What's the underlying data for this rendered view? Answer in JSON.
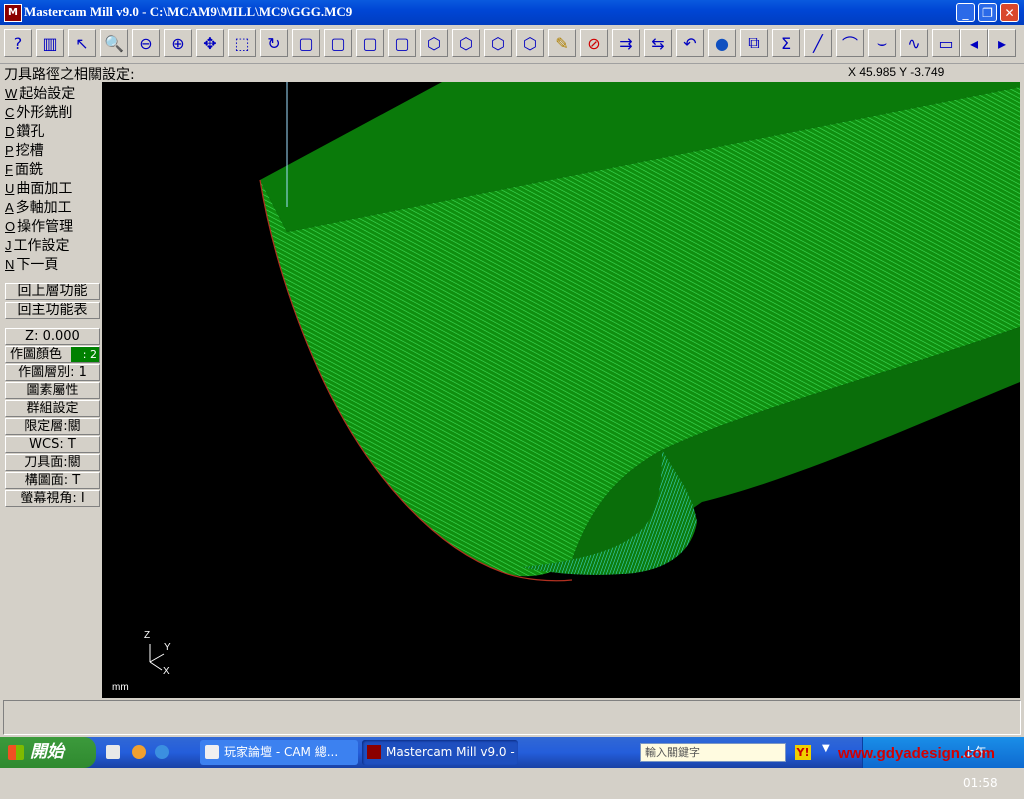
{
  "window": {
    "title": "Mastercam Mill v9.0 - C:\\MCAM9\\MILL\\MC9\\GGG.MC9",
    "icon_text": "M",
    "controls": [
      "_",
      "❐",
      "✕"
    ]
  },
  "toolbar": {
    "icons": [
      "help-icon",
      "calculator-icon",
      "analyze-icon",
      "zoom-window-icon",
      "zoom-out-icon",
      "zoom-scale-icon",
      "pan-icon",
      "select-icon",
      "view-rotate-icon",
      "top-view-icon",
      "front-view-icon",
      "side-view-icon",
      "iso-view-icon",
      "shaded-cube-icon",
      "cube-a-icon",
      "cube-b-icon",
      "cube-c-icon",
      "pencil-icon",
      "delete-icon",
      "translate-icon",
      "mirror-icon",
      "undo-icon",
      "sphere-icon",
      "group-icon",
      "sum-icon",
      "line-icon",
      "arc-icon",
      "fillet-icon",
      "spline-icon",
      "rectangle-icon",
      "prev-icon",
      "next-icon"
    ],
    "glyphs": [
      "?",
      "▥",
      "↖",
      "🔍",
      "⊖",
      "⊕",
      "✥",
      "⬚",
      "↻",
      "▢",
      "▢",
      "▢",
      "▢",
      "⬡",
      "⬡",
      "⬡",
      "⬡",
      "✎",
      "⊘",
      "⇉",
      "⇆",
      "↶",
      "●",
      "⧉",
      "Σ",
      "╱",
      "⌒",
      "⌣",
      "∿",
      "▭",
      "◂",
      "▸"
    ]
  },
  "prompt": "刀具路徑之相關設定:",
  "coords": "X 45.985   Y -3.749",
  "menu": {
    "items": [
      {
        "key": "W",
        "label": "起始設定"
      },
      {
        "key": "C",
        "label": "外形銑削"
      },
      {
        "key": "D",
        "label": "鑽孔"
      },
      {
        "key": "P",
        "label": "挖槽"
      },
      {
        "key": "F",
        "label": "面銑"
      },
      {
        "key": "U",
        "label": "曲面加工"
      },
      {
        "key": "A",
        "label": "多軸加工"
      },
      {
        "key": "O",
        "label": "操作管理"
      },
      {
        "key": "J",
        "label": "工作設定"
      },
      {
        "key": "N",
        "label": "下一頁"
      }
    ],
    "back_up": "回上層功能",
    "main_menu": "回主功能表"
  },
  "params": {
    "z": "Z:  0.000",
    "color": "作圖顏色",
    "color_value": ": 2",
    "level": "作圖層別: 1",
    "attributes": "圖素屬性",
    "groups": "群組設定",
    "mask": "限定層:關",
    "wcs": "WCS:  T",
    "tplane": "刀具面:關",
    "cplane": "構圖面: T",
    "gview": "螢幕視角: I"
  },
  "viewport": {
    "axes": {
      "z": "Z",
      "y": "Y",
      "x": "X"
    },
    "unit": "mm",
    "colors": {
      "background": "#000000",
      "surface": "#0a7a0a",
      "toolpath": "#39d353",
      "toolpath_cyan": "#40e0e0",
      "edge": "#b03020"
    }
  },
  "taskbar": {
    "start": "開始",
    "tasks": [
      "玩家論壇 - CAM 總...",
      "Mastercam Mill v9.0 - ..."
    ],
    "search_placeholder": "輸入關鍵字",
    "watermark": "www.gdyadesign.com",
    "clock": "上午 01:58"
  }
}
